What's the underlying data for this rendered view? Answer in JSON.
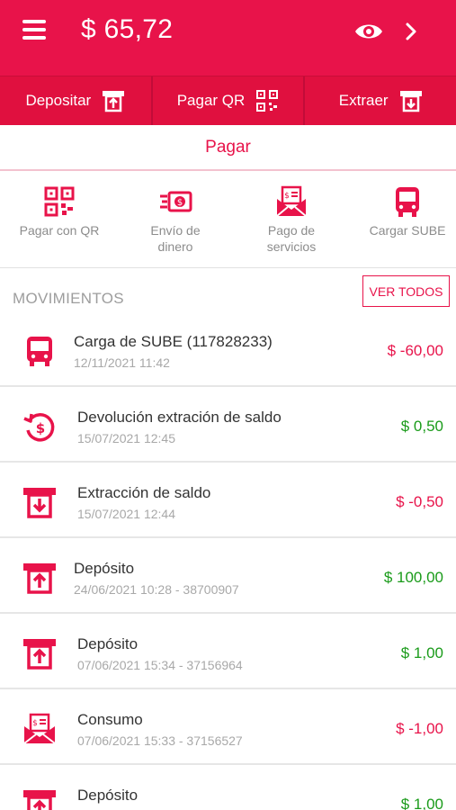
{
  "header": {
    "balance": "$ 65,72"
  },
  "actions": [
    {
      "label": "Depositar",
      "icon": "deposit-icon"
    },
    {
      "label": "Pagar QR",
      "icon": "qr-icon"
    },
    {
      "label": "Extraer",
      "icon": "withdraw-icon"
    }
  ],
  "tab": {
    "label": "Pagar"
  },
  "shortcuts": [
    {
      "label": "Pagar con QR",
      "icon": "qr-icon"
    },
    {
      "label": "Envío de\ndinero",
      "icon": "money-transfer-icon"
    },
    {
      "label": "Pago de\nservicios",
      "icon": "bill-envelope-icon"
    },
    {
      "label": "Cargar SUBE",
      "icon": "bus-icon"
    }
  ],
  "movements_section": {
    "title": "MOVIMIENTOS",
    "view_all_label": "VER TODOS"
  },
  "movements": [
    {
      "title": "Carga de SUBE (117828233)",
      "subtitle": "12/11/2021 11:42",
      "amount": "$ -60,00",
      "type": "negative",
      "icon": "bus-icon"
    },
    {
      "title": "Devolución extración de saldo",
      "subtitle": "15/07/2021 12:45",
      "amount": "$ 0,50",
      "type": "positive",
      "icon": "refund-icon"
    },
    {
      "title": "Extracción de saldo",
      "subtitle": "15/07/2021 12:44",
      "amount": "$ -0,50",
      "type": "negative",
      "icon": "withdraw-icon"
    },
    {
      "title": "Depósito",
      "subtitle": "24/06/2021 10:28 - 38700907",
      "amount": "$ 100,00",
      "type": "positive",
      "icon": "deposit-icon"
    },
    {
      "title": "Depósito",
      "subtitle": "07/06/2021 15:34 - 37156964",
      "amount": "$ 1,00",
      "type": "positive",
      "icon": "deposit-icon"
    },
    {
      "title": "Consumo",
      "subtitle": "07/06/2021 15:33 - 37156527",
      "amount": "$ -1,00",
      "type": "negative",
      "icon": "bill-envelope-icon"
    },
    {
      "title": "Depósito",
      "subtitle": "",
      "amount": "$ 1,00",
      "type": "positive",
      "icon": "deposit-icon"
    }
  ],
  "colors": {
    "brand": "#e8134a",
    "positive": "#1a9b1a",
    "negative": "#e8134a"
  }
}
